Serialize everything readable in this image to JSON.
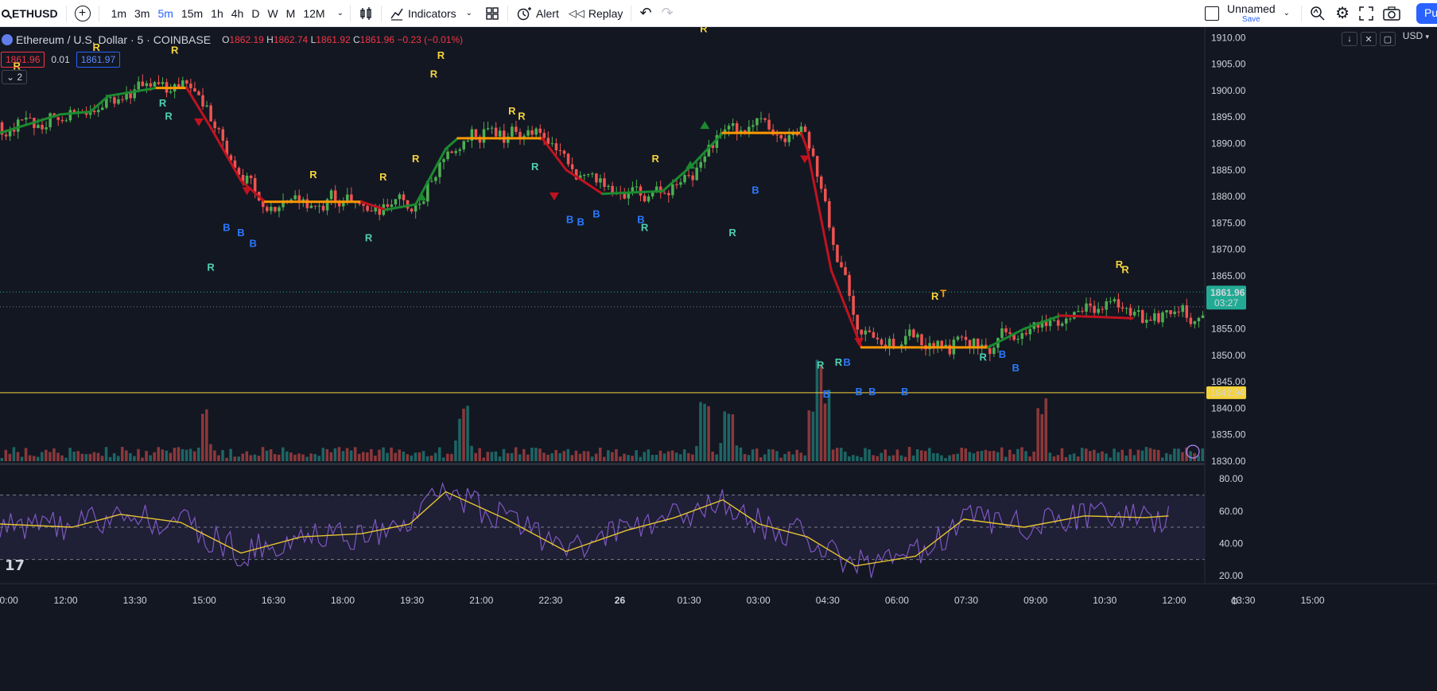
{
  "toolbar": {
    "symbol": "ETHUSD",
    "timeframes": [
      {
        "label": "1m",
        "active": false
      },
      {
        "label": "3m",
        "active": false
      },
      {
        "label": "5m",
        "active": true
      },
      {
        "label": "15m",
        "active": false
      },
      {
        "label": "1h",
        "active": false
      },
      {
        "label": "4h",
        "active": false
      },
      {
        "label": "D",
        "active": false
      },
      {
        "label": "W",
        "active": false
      },
      {
        "label": "M",
        "active": false
      },
      {
        "label": "12M",
        "active": false
      }
    ],
    "indicators_label": "Indicators",
    "alert_label": "Alert",
    "replay_label": "Replay",
    "layout_name": "Unnamed",
    "save_label": "Save",
    "publish_label": "Pu"
  },
  "legend": {
    "title": "Ethereum / U.S. Dollar · 5 · COINBASE",
    "o_label": "O",
    "o": "1862.19",
    "h_label": "H",
    "h": "1862.74",
    "l_label": "L",
    "l": "1861.92",
    "c_label": "C",
    "c": "1861.96",
    "change": "−0.23 (−0.01%)",
    "sell_price": "1861.96",
    "spread": "0.01",
    "buy_price": "1861.97",
    "collapse_count": "2"
  },
  "currency": "USD",
  "colors": {
    "background": "#131722",
    "up": "#4caf50",
    "down": "#ef5350",
    "accent": "#2962ff",
    "price_tag": "#22ab94",
    "support_line": "#f5d33d",
    "rsi": "#7e57c2",
    "rsi_ma": "#e6c532"
  },
  "price_axis": {
    "ticks": [
      "1910.00",
      "1905.00",
      "1900.00",
      "1895.00",
      "1890.00",
      "1885.00",
      "1880.00",
      "1875.00",
      "1870.00",
      "1865.00",
      "1855.00",
      "1850.00",
      "1845.00",
      "1840.00",
      "1835.00",
      "1830.00"
    ],
    "current_price": "1861.96",
    "countdown": "03:27",
    "support_price": "1842.94"
  },
  "rsi_axis": {
    "ticks": [
      "80.00",
      "60.00",
      "40.00",
      "20.00"
    ]
  },
  "time_axis": {
    "ticks": [
      "0:00",
      "12:00",
      "13:30",
      "15:00",
      "16:30",
      "18:00",
      "19:30",
      "21:00",
      "22:30",
      "26",
      "01:30",
      "03:00",
      "04:30",
      "06:00",
      "07:30",
      "09:00",
      "10:30",
      "12:00",
      "13:30",
      "15:00"
    ]
  },
  "chart_data": {
    "type": "candlestick",
    "symbol": "ETHUSD",
    "interval": "5",
    "exchange": "COINBASE",
    "ylim": [
      1830,
      1912
    ],
    "ma_line": [
      {
        "t": 0,
        "p": 1892
      },
      {
        "t": 0.05,
        "p": 1895.5
      },
      {
        "t": 0.075,
        "p": 1896
      },
      {
        "t": 0.09,
        "p": 1899
      },
      {
        "t": 0.13,
        "p": 1900.5
      },
      {
        "t": 0.155,
        "p": 1900.5
      },
      {
        "t": 0.175,
        "p": 1893
      },
      {
        "t": 0.2,
        "p": 1883
      },
      {
        "t": 0.22,
        "p": 1879
      },
      {
        "t": 0.3,
        "p": 1879
      },
      {
        "t": 0.32,
        "p": 1877.5
      },
      {
        "t": 0.345,
        "p": 1878.5
      },
      {
        "t": 0.37,
        "p": 1889
      },
      {
        "t": 0.38,
        "p": 1891
      },
      {
        "t": 0.45,
        "p": 1891
      },
      {
        "t": 0.47,
        "p": 1885
      },
      {
        "t": 0.5,
        "p": 1880.5
      },
      {
        "t": 0.55,
        "p": 1881
      },
      {
        "t": 0.575,
        "p": 1886
      },
      {
        "t": 0.6,
        "p": 1892
      },
      {
        "t": 0.61,
        "p": 1892
      },
      {
        "t": 0.665,
        "p": 1892
      },
      {
        "t": 0.67,
        "p": 1889
      },
      {
        "t": 0.69,
        "p": 1866
      },
      {
        "t": 0.715,
        "p": 1851.5
      },
      {
        "t": 0.73,
        "p": 1851.5
      },
      {
        "t": 0.82,
        "p": 1851.5
      },
      {
        "t": 0.85,
        "p": 1855
      },
      {
        "t": 0.88,
        "p": 1857.5
      },
      {
        "t": 0.94,
        "p": 1857
      }
    ],
    "volume_spikes": [
      0.17,
      0.385,
      0.585,
      0.605,
      0.675,
      0.68,
      0.685,
      0.865
    ],
    "support_level": 1842.94,
    "current_price": 1861.96,
    "signals": [
      {
        "label": "R",
        "t": 0.014,
        "p": 1904,
        "kind": "sell"
      },
      {
        "label": "R",
        "t": 0.08,
        "p": 1907.5,
        "kind": "sell"
      },
      {
        "label": "R",
        "t": 0.145,
        "p": 1907,
        "kind": "sell"
      },
      {
        "label": "R",
        "t": 0.135,
        "p": 1897,
        "kind": "buy"
      },
      {
        "label": "R",
        "t": 0.14,
        "p": 1894.5,
        "kind": "buy"
      },
      {
        "label": "B",
        "t": 0.188,
        "p": 1873.5,
        "kind": "blue"
      },
      {
        "label": "B",
        "t": 0.2,
        "p": 1872.5,
        "kind": "blue"
      },
      {
        "label": "B",
        "t": 0.21,
        "p": 1870.5,
        "kind": "blue"
      },
      {
        "label": "R",
        "t": 0.175,
        "p": 1866,
        "kind": "buy"
      },
      {
        "label": "R",
        "t": 0.26,
        "p": 1883.5,
        "kind": "sell"
      },
      {
        "label": "R",
        "t": 0.318,
        "p": 1883,
        "kind": "sell"
      },
      {
        "label": "R",
        "t": 0.306,
        "p": 1871.5,
        "kind": "buy"
      },
      {
        "label": "R",
        "t": 0.345,
        "p": 1886.5,
        "kind": "sell"
      },
      {
        "label": "R",
        "t": 0.36,
        "p": 1902.5,
        "kind": "sell"
      },
      {
        "label": "R",
        "t": 0.366,
        "p": 1906,
        "kind": "sell"
      },
      {
        "label": "R",
        "t": 0.425,
        "p": 1895.5,
        "kind": "sell"
      },
      {
        "label": "R",
        "t": 0.433,
        "p": 1894.5,
        "kind": "sell"
      },
      {
        "label": "R",
        "t": 0.444,
        "p": 1885,
        "kind": "buy"
      },
      {
        "label": "B",
        "t": 0.473,
        "p": 1875,
        "kind": "blue"
      },
      {
        "label": "B",
        "t": 0.482,
        "p": 1874.5,
        "kind": "blue"
      },
      {
        "label": "B",
        "t": 0.495,
        "p": 1876,
        "kind": "blue"
      },
      {
        "label": "B",
        "t": 0.532,
        "p": 1875,
        "kind": "blue"
      },
      {
        "label": "R",
        "t": 0.535,
        "p": 1873.5,
        "kind": "buy"
      },
      {
        "label": "R",
        "t": 0.544,
        "p": 1886.5,
        "kind": "sell"
      },
      {
        "label": "R",
        "t": 0.584,
        "p": 1911,
        "kind": "sell"
      },
      {
        "label": "B",
        "t": 0.627,
        "p": 1880.5,
        "kind": "blue"
      },
      {
        "label": "R",
        "t": 0.608,
        "p": 1872.5,
        "kind": "buy"
      },
      {
        "label": "R",
        "t": 0.681,
        "p": 1847.5,
        "kind": "buy"
      },
      {
        "label": "B",
        "t": 0.686,
        "p": 1842,
        "kind": "blue"
      },
      {
        "label": "R",
        "t": 0.696,
        "p": 1848,
        "kind": "buy"
      },
      {
        "label": "B",
        "t": 0.703,
        "p": 1848,
        "kind": "blue"
      },
      {
        "label": "B",
        "t": 0.713,
        "p": 1842.5,
        "kind": "blue"
      },
      {
        "label": "B",
        "t": 0.724,
        "p": 1842.5,
        "kind": "blue"
      },
      {
        "label": "B",
        "t": 0.751,
        "p": 1842.5,
        "kind": "blue"
      },
      {
        "label": "R",
        "t": 0.776,
        "p": 1860.5,
        "kind": "sell"
      },
      {
        "label": "T",
        "t": 0.783,
        "p": 1861,
        "kind": "target"
      },
      {
        "label": "R",
        "t": 0.816,
        "p": 1849,
        "kind": "buy"
      },
      {
        "label": "B",
        "t": 0.832,
        "p": 1849.5,
        "kind": "blue"
      },
      {
        "label": "B",
        "t": 0.843,
        "p": 1847,
        "kind": "blue"
      },
      {
        "label": "R",
        "t": 0.929,
        "p": 1866.5,
        "kind": "sell"
      },
      {
        "label": "R",
        "t": 0.934,
        "p": 1865.5,
        "kind": "sell"
      }
    ],
    "rsi": {
      "ylim": [
        15,
        88
      ],
      "levels": [
        70,
        50,
        30
      ],
      "ma_points": [
        {
          "t": 0,
          "v": 52
        },
        {
          "t": 0.06,
          "v": 50
        },
        {
          "t": 0.1,
          "v": 58
        },
        {
          "t": 0.15,
          "v": 53
        },
        {
          "t": 0.2,
          "v": 34
        },
        {
          "t": 0.25,
          "v": 44
        },
        {
          "t": 0.3,
          "v": 46
        },
        {
          "t": 0.34,
          "v": 52
        },
        {
          "t": 0.37,
          "v": 72
        },
        {
          "t": 0.42,
          "v": 55
        },
        {
          "t": 0.47,
          "v": 35
        },
        {
          "t": 0.52,
          "v": 48
        },
        {
          "t": 0.56,
          "v": 56
        },
        {
          "t": 0.6,
          "v": 67
        },
        {
          "t": 0.63,
          "v": 52
        },
        {
          "t": 0.67,
          "v": 44
        },
        {
          "t": 0.71,
          "v": 26
        },
        {
          "t": 0.76,
          "v": 32
        },
        {
          "t": 0.8,
          "v": 55
        },
        {
          "t": 0.85,
          "v": 50
        },
        {
          "t": 0.9,
          "v": 57
        },
        {
          "t": 0.95,
          "v": 56
        },
        {
          "t": 0.97,
          "v": 57
        }
      ]
    }
  }
}
